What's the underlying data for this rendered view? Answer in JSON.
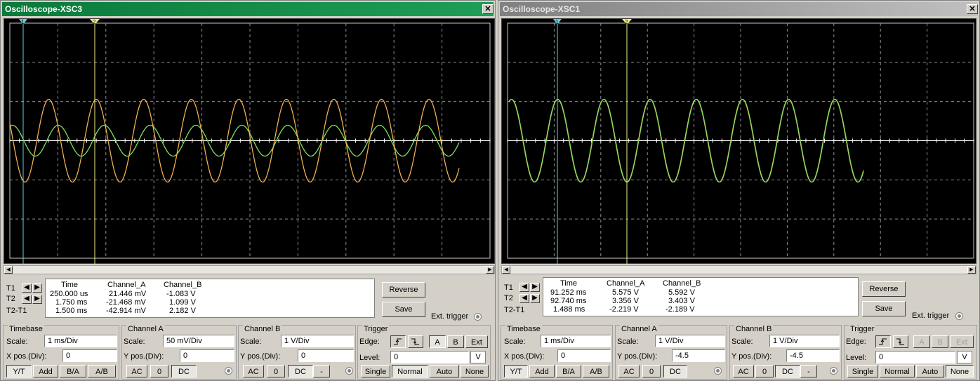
{
  "win1": {
    "title": "Oscilloscope-XSC3",
    "close": "✕",
    "cursor_t1": "1",
    "cursor_t2": "2",
    "readout": {
      "headers": [
        "Time",
        "Channel_A",
        "Channel_B"
      ],
      "rows": [
        {
          "label": "T1",
          "time": "250.000 us",
          "a": "21.446 mV",
          "b": "-1.083 V"
        },
        {
          "label": "T2",
          "time": "1.750 ms",
          "a": "-21.468 mV",
          "b": "1.099 V"
        },
        {
          "label": "T2-T1",
          "time": "1.500 ms",
          "a": "-42.914 mV",
          "b": "2.182 V"
        }
      ]
    },
    "reverse": "Reverse",
    "save": "Save",
    "ext_trigger": "Ext. trigger",
    "timebase": {
      "title": "Timebase",
      "scale_label": "Scale:",
      "scale": "1 ms/Div",
      "pos_label": "X pos.(Div):",
      "pos": "0",
      "b1": "Y/T",
      "b2": "Add",
      "b3": "B/A",
      "b4": "A/B"
    },
    "channel_a": {
      "title": "Channel A",
      "scale_label": "Scale:",
      "scale": "50 mV/Div",
      "pos_label": "Y pos.(Div):",
      "pos": "0",
      "ac": "AC",
      "zero": "0",
      "dc": "DC"
    },
    "channel_b": {
      "title": "Channel B",
      "scale_label": "Scale:",
      "scale": "1 V/Div",
      "pos_label": "Y pos.(Div):",
      "pos": "0",
      "ac": "AC",
      "zero": "0",
      "dc": "DC",
      "minus": "-"
    },
    "trigger": {
      "title": "Trigger",
      "edge_label": "Edge:",
      "a": "A",
      "b": "B",
      "ext": "Ext",
      "level_label": "Level:",
      "level": "0",
      "unit": "V",
      "single": "Single",
      "normal": "Normal",
      "auto": "Auto",
      "none": "None"
    }
  },
  "win2": {
    "title": "Oscilloscope-XSC1",
    "close": "✕",
    "cursor_t1": "1",
    "cursor_t2": "2",
    "readout": {
      "headers": [
        "Time",
        "Channel_A",
        "Channel_B"
      ],
      "rows": [
        {
          "label": "T1",
          "time": "91.252 ms",
          "a": "5.575 V",
          "b": "5.592 V"
        },
        {
          "label": "T2",
          "time": "92.740 ms",
          "a": "3.356 V",
          "b": "3.403 V"
        },
        {
          "label": "T2-T1",
          "time": "1.488 ms",
          "a": "-2.219 V",
          "b": "-2.189 V"
        }
      ]
    },
    "reverse": "Reverse",
    "save": "Save",
    "ext_trigger": "Ext. trigger",
    "timebase": {
      "title": "Timebase",
      "scale_label": "Scale:",
      "scale": "1 ms/Div",
      "pos_label": "X pos.(Div):",
      "pos": "0",
      "b1": "Y/T",
      "b2": "Add",
      "b3": "B/A",
      "b4": "A/B"
    },
    "channel_a": {
      "title": "Channel A",
      "scale_label": "Scale:",
      "scale": "1 V/Div",
      "pos_label": "Y pos.(Div):",
      "pos": "-4.5",
      "ac": "AC",
      "zero": "0",
      "dc": "DC"
    },
    "channel_b": {
      "title": "Channel B",
      "scale_label": "Scale:",
      "scale": "1 V/Div",
      "pos_label": "Y pos.(Div):",
      "pos": "-4.5",
      "ac": "AC",
      "zero": "0",
      "dc": "DC",
      "minus": "-"
    },
    "trigger": {
      "title": "Trigger",
      "edge_label": "Edge:",
      "a": "A",
      "b": "B",
      "ext": "Ext",
      "level_label": "Level:",
      "level": "0",
      "unit": "V",
      "single": "Single",
      "normal": "Normal",
      "auto": "Auto",
      "none": "None"
    }
  },
  "colors": {
    "trace_a": "#f0b050",
    "trace_b": "#7ee060",
    "cursor1": "#5ed0e0",
    "cursor2": "#f0f080",
    "grid": "#909090"
  },
  "icons": {
    "edge_rise": "rising-edge-icon",
    "edge_fall": "falling-edge-icon",
    "left": "arrow-left-icon",
    "right": "arrow-right-icon"
  }
}
